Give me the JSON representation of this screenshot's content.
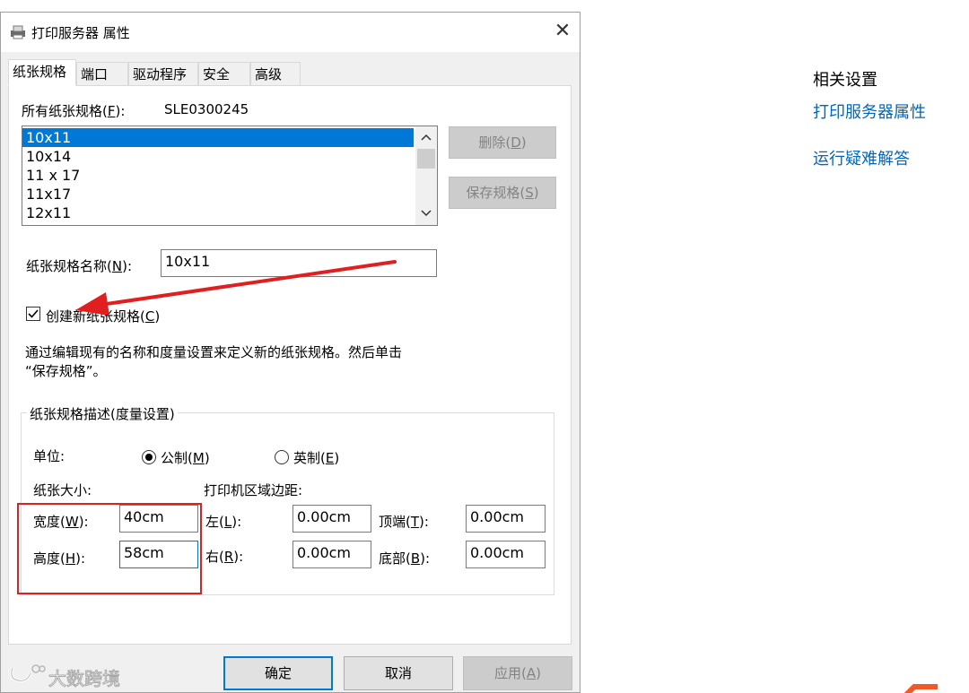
{
  "dialog": {
    "title": "打印服务器 属性",
    "close_glyph": "✕",
    "tabs": [
      {
        "label": "纸张规格",
        "active": true
      },
      {
        "label": "端口"
      },
      {
        "label": "驱动程序"
      },
      {
        "label": "安全"
      },
      {
        "label": "高级"
      }
    ]
  },
  "forms_tab": {
    "all_forms_label": "所有纸张规格(F):",
    "server_name": "SLE0300245",
    "forms_list": [
      "10x11",
      "10x14",
      "11 x 17",
      "11x17",
      "12x11"
    ],
    "selected_form": "10x11",
    "delete_button": "删除(D)",
    "save_form_button": "保存规格(S)",
    "form_name_label": "纸张规格名称(N):",
    "form_name_value": "10x11",
    "create_new_checkbox": {
      "label": "创建新纸张规格(C)",
      "checked": true
    },
    "help_text_line1": "通过编辑现有的名称和度量设置来定义新的纸张规格。然后单击",
    "help_text_line2": "“保存规格”。",
    "measurements_group_label": "纸张规格描述(度量设置)",
    "units_label": "单位:",
    "metric_radio": {
      "label": "公制(M)",
      "checked": true
    },
    "english_radio": {
      "label": "英制(E)",
      "checked": false
    },
    "paper_size_label": "纸张大小:",
    "margins_label": "打印机区域边距:",
    "width_label": "宽度(W):",
    "width_value": "40cm",
    "height_label": "高度(H):",
    "height_value": "58cm",
    "left_label": "左(L):",
    "left_value": "0.00cm",
    "right_label": "右(R):",
    "right_value": "0.00cm",
    "top_label": "顶端(T):",
    "top_value": "0.00cm",
    "bottom_label": "底部(B):",
    "bottom_value": "0.00cm"
  },
  "footer": {
    "ok_button": "确定",
    "cancel_button": "取消",
    "apply_button": "应用(A)"
  },
  "related_settings": {
    "heading": "相关设置",
    "links": [
      "打印服务器属性",
      "运行疑难解答"
    ]
  },
  "watermark": "大数跨境",
  "colors": {
    "accent": "#0078d7",
    "link": "#0067c0",
    "annotation_red": "#e02020"
  }
}
